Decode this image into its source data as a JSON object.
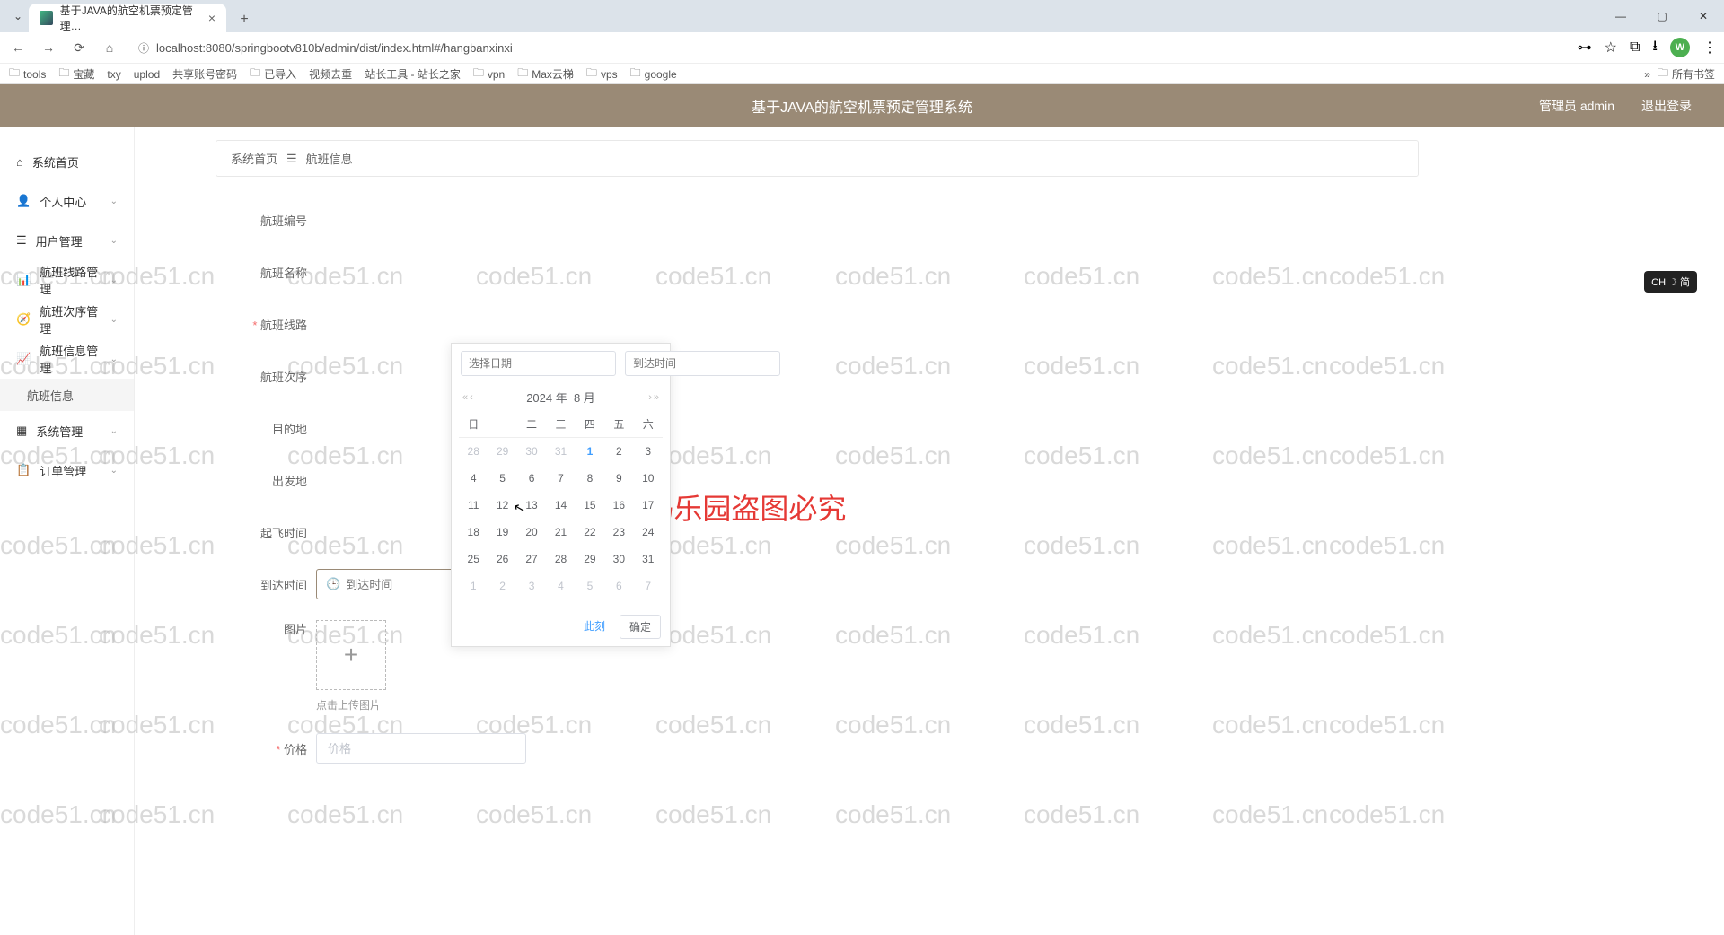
{
  "browser": {
    "tab_title": "基于JAVA的航空机票预定管理…",
    "url": "localhost:8080/springbootv810b/admin/dist/index.html#/hangbanxinxi",
    "avatar_letter": "W",
    "bookmarks": [
      "tools",
      "宝藏",
      "txy",
      "uplod",
      "共享账号密码",
      "已导入",
      "视频去重",
      "站长工具 - 站长之家",
      "vpn",
      "Max云梯",
      "vps",
      "google"
    ],
    "all_bookmarks_label": "所有书签"
  },
  "app": {
    "title": "基于JAVA的航空机票预定管理系统",
    "user_label": "管理员 admin",
    "logout_label": "退出登录",
    "breadcrumb_home": "系统首页",
    "breadcrumb_current": "航班信息",
    "ime_badge": "CH ☽ 简"
  },
  "sidebar": {
    "items": [
      {
        "icon": "home",
        "label": "系统首页",
        "expandable": false
      },
      {
        "icon": "user",
        "label": "个人中心",
        "expandable": true
      },
      {
        "icon": "list",
        "label": "用户管理",
        "expandable": true
      },
      {
        "icon": "chart",
        "label": "航班线路管理",
        "expandable": true
      },
      {
        "icon": "route",
        "label": "航班次序管理",
        "expandable": true
      },
      {
        "icon": "bar",
        "label": "航班信息管理",
        "expandable": true
      }
    ],
    "active_sub": "航班信息",
    "items2": [
      {
        "icon": "grid",
        "label": "系统管理",
        "expandable": true
      },
      {
        "icon": "order",
        "label": "订单管理",
        "expandable": true
      }
    ]
  },
  "form": {
    "labels": {
      "flight_no": "航班编号",
      "flight_name": "航班名称",
      "route": "航班线路",
      "order": "航班次序",
      "dest": "目的地",
      "depart": "出发地",
      "takeoff": "起飞时间",
      "arrive": "到达时间",
      "image": "图片",
      "price": "价格"
    },
    "placeholders": {
      "arrive": "到达时间",
      "price": "价格"
    },
    "upload_hint": "点击上传图片"
  },
  "datepicker": {
    "date_placeholder": "选择日期",
    "time_placeholder": "到达时间",
    "year": "2024 年",
    "month": "8 月",
    "weekdays": [
      "日",
      "一",
      "二",
      "三",
      "四",
      "五",
      "六"
    ],
    "rows": [
      [
        {
          "d": "28",
          "o": 1
        },
        {
          "d": "29",
          "o": 1
        },
        {
          "d": "30",
          "o": 1
        },
        {
          "d": "31",
          "o": 1
        },
        {
          "d": "1",
          "t": 1
        },
        {
          "d": "2"
        },
        {
          "d": "3"
        }
      ],
      [
        {
          "d": "4"
        },
        {
          "d": "5"
        },
        {
          "d": "6"
        },
        {
          "d": "7"
        },
        {
          "d": "8"
        },
        {
          "d": "9"
        },
        {
          "d": "10"
        }
      ],
      [
        {
          "d": "11"
        },
        {
          "d": "12"
        },
        {
          "d": "13"
        },
        {
          "d": "14"
        },
        {
          "d": "15"
        },
        {
          "d": "16"
        },
        {
          "d": "17"
        }
      ],
      [
        {
          "d": "18"
        },
        {
          "d": "19"
        },
        {
          "d": "20"
        },
        {
          "d": "21"
        },
        {
          "d": "22"
        },
        {
          "d": "23"
        },
        {
          "d": "24"
        }
      ],
      [
        {
          "d": "25"
        },
        {
          "d": "26"
        },
        {
          "d": "27"
        },
        {
          "d": "28"
        },
        {
          "d": "29"
        },
        {
          "d": "30"
        },
        {
          "d": "31"
        }
      ],
      [
        {
          "d": "1",
          "o": 1
        },
        {
          "d": "2",
          "o": 1
        },
        {
          "d": "3",
          "o": 1
        },
        {
          "d": "4",
          "o": 1
        },
        {
          "d": "5",
          "o": 1
        },
        {
          "d": "6",
          "o": 1
        },
        {
          "d": "7",
          "o": 1
        }
      ]
    ],
    "btn_now": "此刻",
    "btn_ok": "确定"
  },
  "watermark": {
    "text": "code51.cn",
    "red_text": "code51.cn-源码乐园盗图必究"
  }
}
